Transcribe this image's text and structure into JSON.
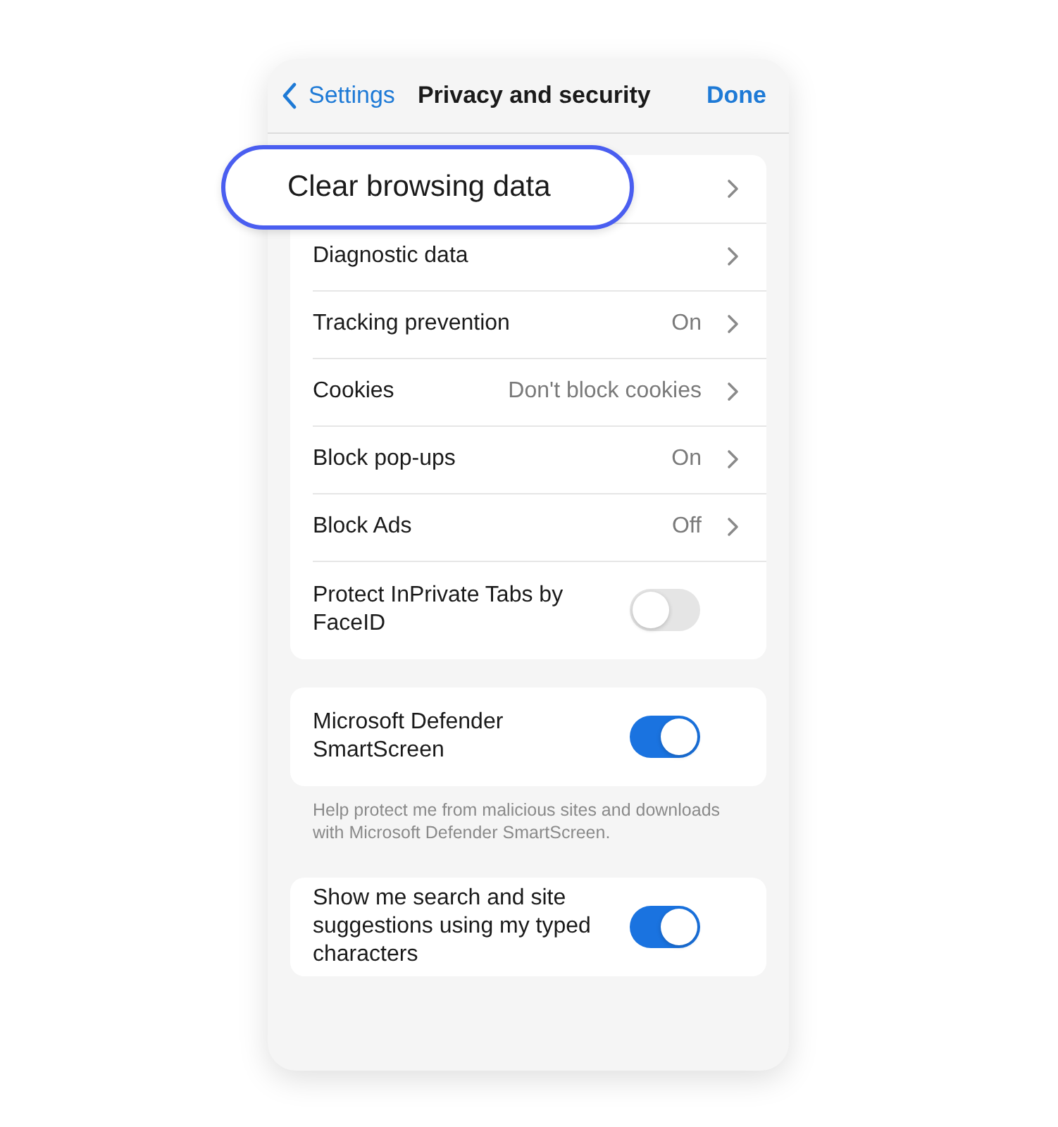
{
  "nav": {
    "back": "Settings",
    "title": "Privacy and security",
    "done": "Done"
  },
  "groups": [
    {
      "rows": [
        {
          "kind": "link",
          "label": "Clear browsing data",
          "highlighted": true
        },
        {
          "kind": "link",
          "label": "Diagnostic data",
          "highlighted": false
        },
        {
          "kind": "link",
          "label": "Tracking prevention",
          "value": "On",
          "highlighted": false
        },
        {
          "kind": "link",
          "label": "Cookies",
          "value": "Don't block cookies",
          "highlighted": false
        },
        {
          "kind": "link",
          "label": "Block pop-ups",
          "value": "On",
          "highlighted": false
        },
        {
          "kind": "link",
          "label": "Block Ads",
          "value": "Off",
          "highlighted": false
        },
        {
          "kind": "toggle",
          "label": "Protect InPrivate Tabs by FaceID",
          "on": false,
          "highlighted": false
        }
      ]
    },
    {
      "rows": [
        {
          "kind": "toggle",
          "label": "Microsoft Defender SmartScreen",
          "on": true,
          "highlighted": false
        }
      ],
      "footer": "Help protect me from malicious sites and downloads with Microsoft Defender SmartScreen."
    },
    {
      "rows": [
        {
          "kind": "toggle",
          "label": "Show me search and site suggestions using my typed characters",
          "on": true,
          "highlighted": false
        }
      ]
    }
  ]
}
